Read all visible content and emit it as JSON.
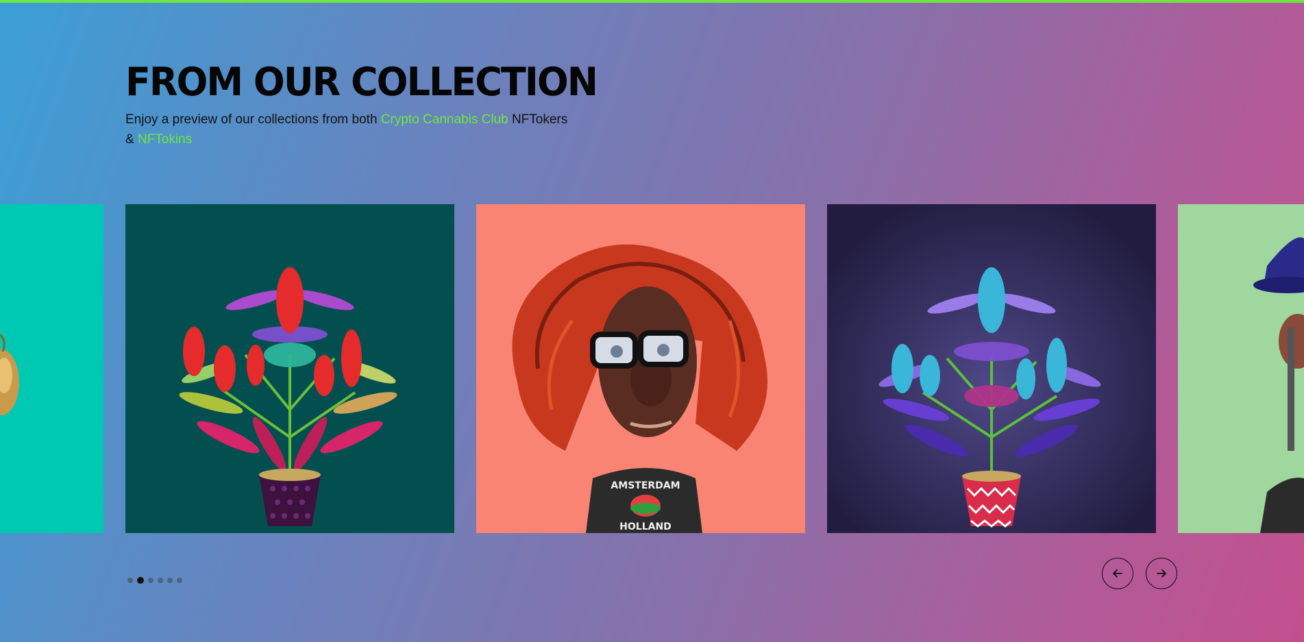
{
  "colors": {
    "top_bar": "#6ee73e",
    "highlight": "#6ee73e",
    "card1_bg": "#00c9b3",
    "card2_bg": "#034f4f",
    "card3_bg": "#fa8473",
    "card4_bg": "#282349",
    "card5_bg": "#9fd79f"
  },
  "section": {
    "title": "FROM OUR COLLECTION",
    "intro_prefix": "Enjoy a preview of our collections from both ",
    "link1": "Crypto Cannabis Club",
    "intro_middle": " NFTokers",
    "intro_amp": "& ",
    "link2": "NFTokins"
  },
  "carousel": {
    "cards": [
      {
        "name": "partial-character",
        "image": "cartoon character portrait (cropped)"
      },
      {
        "name": "red-cannabis-plant",
        "image": "cannabis plant in purple pot"
      },
      {
        "name": "curly-haired-character",
        "image": "character with red curly hair and glasses"
      },
      {
        "name": "blue-cannabis-plant",
        "image": "blue-purple cannabis plant in zigzag pot"
      },
      {
        "name": "hat-character",
        "image": "character with blue hat (cropped)"
      }
    ],
    "shirt_text_top": "AMSTERDAM",
    "shirt_text_bottom": "HOLLAND",
    "pagination_count": 6,
    "active_index": 1,
    "prev_icon": "arrow-left-icon",
    "next_icon": "arrow-right-icon"
  }
}
